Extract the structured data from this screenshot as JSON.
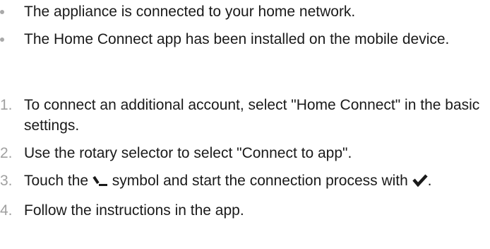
{
  "prerequisites": [
    "The appliance is connected to your home network.",
    "The Home Connect app has been installed on the mobile device."
  ],
  "steps": [
    {
      "number": "1.",
      "text": "To connect an additional account, select \"Home Connect\" in the basic settings."
    },
    {
      "number": "2.",
      "text": "Use the rotary selector to select \"Connect to app\"."
    },
    {
      "number": "3.",
      "text_before": "Touch the",
      "symbol_connect": "connect-symbol-icon",
      "text_middle": "symbol and start the connection process with",
      "symbol_confirm": "checkmark-icon",
      "text_after": "."
    },
    {
      "number": "4.",
      "text": "Follow the instructions in the app."
    }
  ],
  "colors": {
    "text": "#1a1a1a",
    "marker": "#a0a0a0"
  }
}
